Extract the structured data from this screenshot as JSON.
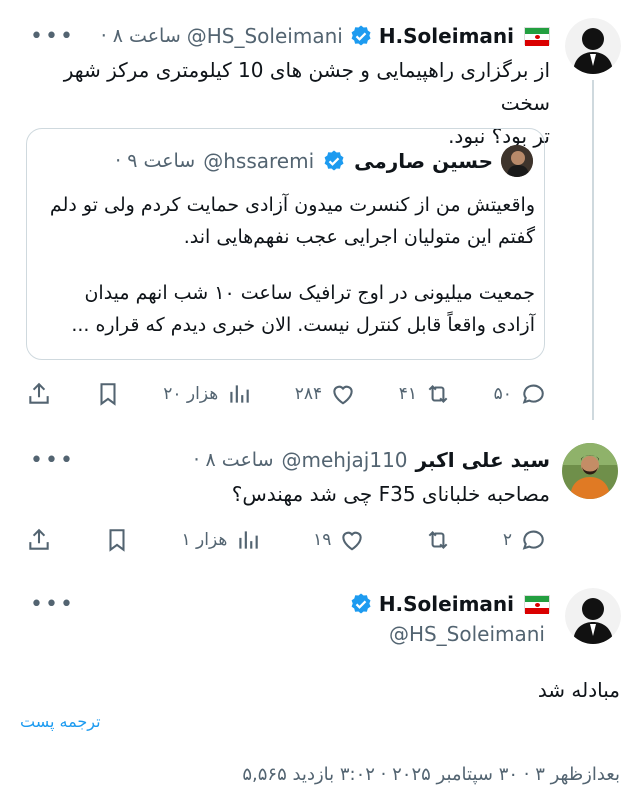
{
  "tweet1": {
    "name": "H.Soleimani",
    "handle": "@HS_Soleimani",
    "time": "· ساعت ۸",
    "text_line1": "از برگزاری راهپیمایی و جشن های 10 کیلومتری مرکز شهر سخت",
    "text_line2": "تر بود؟ نبود.",
    "quote": {
      "name": "حسین صارمی",
      "handle": "@hssaremi",
      "time": "· ساعت ۹",
      "lines": [
        "واقعیتش من از کنسرت میدون آزادی حمایت کردم ولی تو دلم",
        "گفتم این متولیان اجرایی عجب نفهم‌هایی اند.",
        "جمعیت میلیونی در اوج ترافیک ساعت ۱۰ شب انهم میدان",
        "آزادی واقعاً قابل کنترل نیست. الان خبری دیدم که قراره ..."
      ]
    },
    "actions": {
      "replies": "۵۰",
      "retweets": "۴۱",
      "likes": "۲۸۴",
      "views": "۲۰ هزار"
    }
  },
  "tweet2": {
    "name": "سید علی اکبر",
    "handle": "@mehjaj110",
    "time": "· ساعت ۸",
    "text": "مصاحبه خلبانای F35 چی شد مهندس؟",
    "actions": {
      "replies": "۲",
      "retweets": "",
      "likes": "۱۹",
      "views": "۱ هزار"
    }
  },
  "tweet3": {
    "name": "H.Soleimani",
    "handle": "@HS_Soleimani",
    "text": "مبادله شد",
    "translate": "ترجمه پست",
    "meta": "بعدازظهر ۳ · ۳۰ سپتامبر ۲۰۲۵ · ۳:۰۲ بازدید ۵,۵۶۵"
  },
  "colors": {
    "verified": "#1d9bf0",
    "link": "#1d9bf0",
    "text": "#0f1419",
    "muted": "#536471"
  },
  "icons": [
    "more-icon",
    "verified-icon",
    "iran-flag-icon",
    "reply-icon",
    "retweet-icon",
    "like-icon",
    "views-icon",
    "bookmark-icon",
    "share-icon"
  ]
}
